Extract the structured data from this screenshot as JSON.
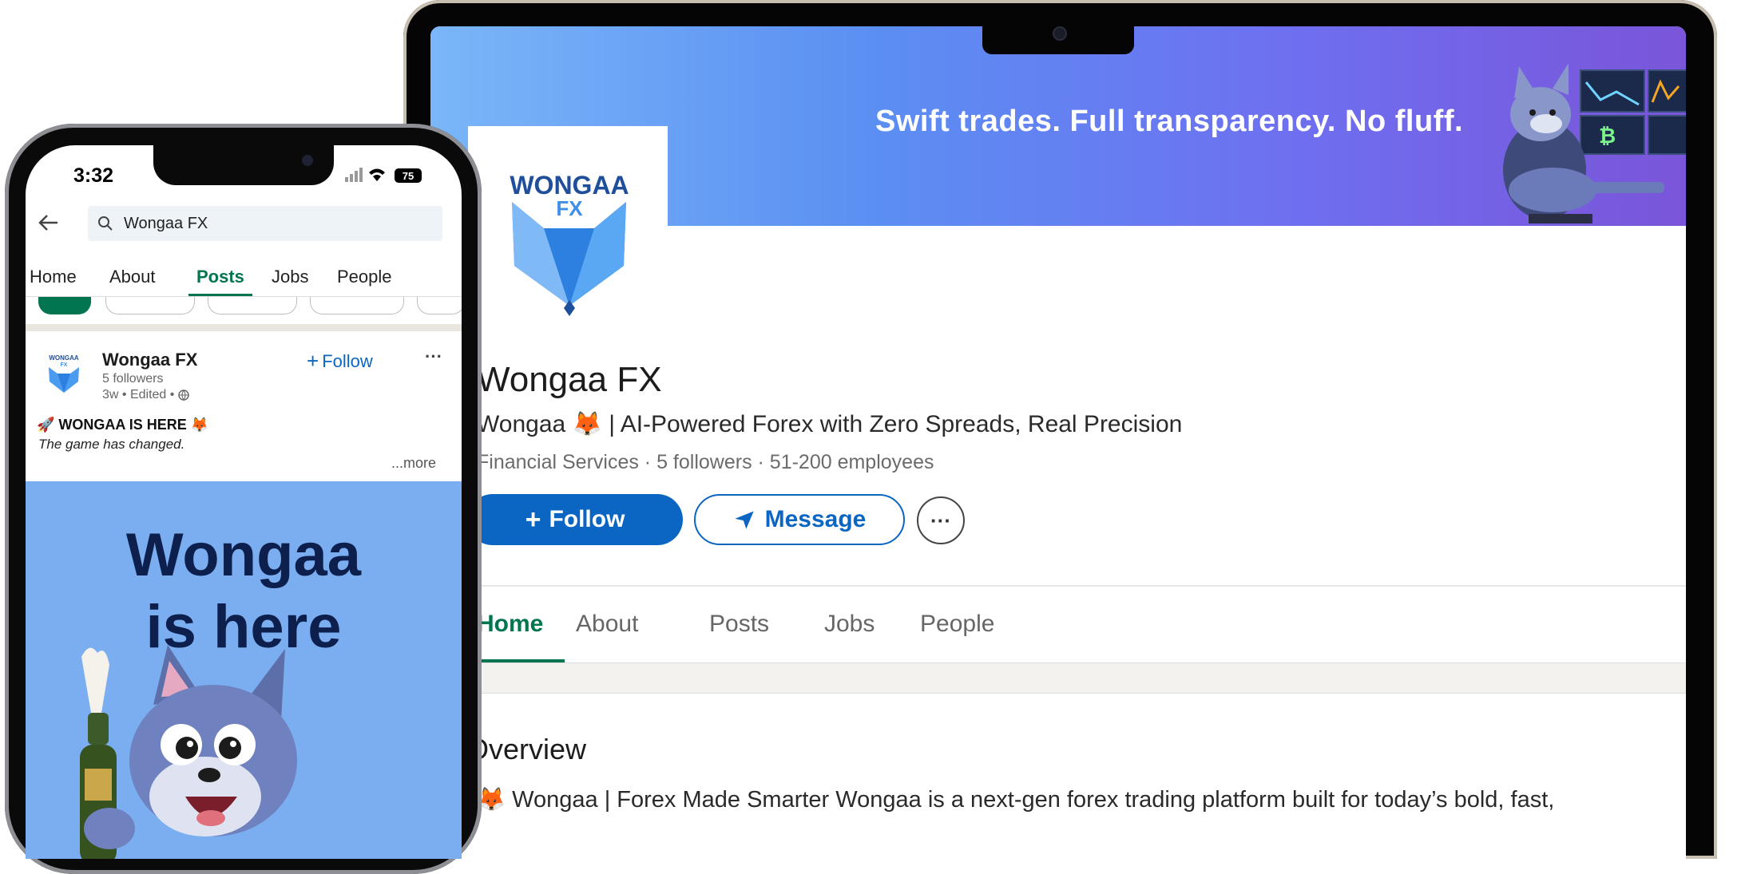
{
  "laptop": {
    "banner_tagline": "Swift trades.  Full transparency. No fluff.",
    "logo": {
      "line1": "WONGAA",
      "line2": "FX"
    },
    "company_name": "Wongaa FX",
    "tagline": "Wongaa 🦊 | AI-Powered Forex with Zero Spreads, Real Precision",
    "meta": "Financial Services · 5 followers · 51-200 employees",
    "follow_label": "Follow",
    "message_label": "Message",
    "more_label": "···",
    "tabs": [
      "Home",
      "About",
      "Posts",
      "Jobs",
      "People"
    ],
    "overview_title": "Overview",
    "overview_text": "🦊 Wongaa | Forex Made Smarter Wongaa is a next-gen forex trading platform built for today’s bold, fast,"
  },
  "phone": {
    "status_time": "3:32",
    "battery": "75",
    "search_value": "Wongaa FX",
    "tabs": [
      "Home",
      "About",
      "Posts",
      "Jobs",
      "People"
    ],
    "active_tab": "Posts",
    "post": {
      "logo": {
        "line1": "WONGAA",
        "line2": "FX"
      },
      "author": "Wongaa FX",
      "followers": "5 followers",
      "time": "3w • Edited •",
      "follow_label": "Follow",
      "more_label": "···",
      "headline": "🚀 WONGAA IS HERE 🦊",
      "subtext": "The game has changed.",
      "see_more": "...more",
      "image_line1": "Wongaa",
      "image_line2": "is here"
    }
  },
  "colors": {
    "linkedin_blue": "#0a66c2",
    "active_green": "#01754f",
    "logo_navy": "#1f4f9a",
    "post_image_bg": "#7aaef0"
  }
}
